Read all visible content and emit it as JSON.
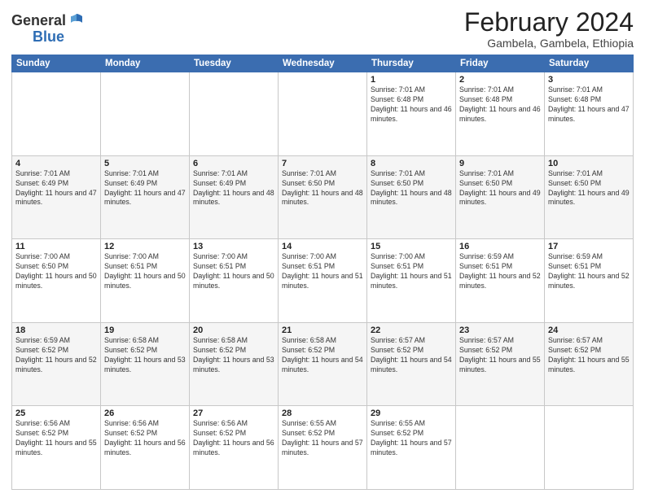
{
  "logo": {
    "general": "General",
    "blue": "Blue"
  },
  "title": "February 2024",
  "subtitle": "Gambela, Gambela, Ethiopia",
  "days_of_week": [
    "Sunday",
    "Monday",
    "Tuesday",
    "Wednesday",
    "Thursday",
    "Friday",
    "Saturday"
  ],
  "weeks": [
    [
      {
        "day": "",
        "info": ""
      },
      {
        "day": "",
        "info": ""
      },
      {
        "day": "",
        "info": ""
      },
      {
        "day": "",
        "info": ""
      },
      {
        "day": "1",
        "info": "Sunrise: 7:01 AM\nSunset: 6:48 PM\nDaylight: 11 hours and 46 minutes."
      },
      {
        "day": "2",
        "info": "Sunrise: 7:01 AM\nSunset: 6:48 PM\nDaylight: 11 hours and 46 minutes."
      },
      {
        "day": "3",
        "info": "Sunrise: 7:01 AM\nSunset: 6:48 PM\nDaylight: 11 hours and 47 minutes."
      }
    ],
    [
      {
        "day": "4",
        "info": "Sunrise: 7:01 AM\nSunset: 6:49 PM\nDaylight: 11 hours and 47 minutes."
      },
      {
        "day": "5",
        "info": "Sunrise: 7:01 AM\nSunset: 6:49 PM\nDaylight: 11 hours and 47 minutes."
      },
      {
        "day": "6",
        "info": "Sunrise: 7:01 AM\nSunset: 6:49 PM\nDaylight: 11 hours and 48 minutes."
      },
      {
        "day": "7",
        "info": "Sunrise: 7:01 AM\nSunset: 6:50 PM\nDaylight: 11 hours and 48 minutes."
      },
      {
        "day": "8",
        "info": "Sunrise: 7:01 AM\nSunset: 6:50 PM\nDaylight: 11 hours and 48 minutes."
      },
      {
        "day": "9",
        "info": "Sunrise: 7:01 AM\nSunset: 6:50 PM\nDaylight: 11 hours and 49 minutes."
      },
      {
        "day": "10",
        "info": "Sunrise: 7:01 AM\nSunset: 6:50 PM\nDaylight: 11 hours and 49 minutes."
      }
    ],
    [
      {
        "day": "11",
        "info": "Sunrise: 7:00 AM\nSunset: 6:50 PM\nDaylight: 11 hours and 50 minutes."
      },
      {
        "day": "12",
        "info": "Sunrise: 7:00 AM\nSunset: 6:51 PM\nDaylight: 11 hours and 50 minutes."
      },
      {
        "day": "13",
        "info": "Sunrise: 7:00 AM\nSunset: 6:51 PM\nDaylight: 11 hours and 50 minutes."
      },
      {
        "day": "14",
        "info": "Sunrise: 7:00 AM\nSunset: 6:51 PM\nDaylight: 11 hours and 51 minutes."
      },
      {
        "day": "15",
        "info": "Sunrise: 7:00 AM\nSunset: 6:51 PM\nDaylight: 11 hours and 51 minutes."
      },
      {
        "day": "16",
        "info": "Sunrise: 6:59 AM\nSunset: 6:51 PM\nDaylight: 11 hours and 52 minutes."
      },
      {
        "day": "17",
        "info": "Sunrise: 6:59 AM\nSunset: 6:51 PM\nDaylight: 11 hours and 52 minutes."
      }
    ],
    [
      {
        "day": "18",
        "info": "Sunrise: 6:59 AM\nSunset: 6:52 PM\nDaylight: 11 hours and 52 minutes."
      },
      {
        "day": "19",
        "info": "Sunrise: 6:58 AM\nSunset: 6:52 PM\nDaylight: 11 hours and 53 minutes."
      },
      {
        "day": "20",
        "info": "Sunrise: 6:58 AM\nSunset: 6:52 PM\nDaylight: 11 hours and 53 minutes."
      },
      {
        "day": "21",
        "info": "Sunrise: 6:58 AM\nSunset: 6:52 PM\nDaylight: 11 hours and 54 minutes."
      },
      {
        "day": "22",
        "info": "Sunrise: 6:57 AM\nSunset: 6:52 PM\nDaylight: 11 hours and 54 minutes."
      },
      {
        "day": "23",
        "info": "Sunrise: 6:57 AM\nSunset: 6:52 PM\nDaylight: 11 hours and 55 minutes."
      },
      {
        "day": "24",
        "info": "Sunrise: 6:57 AM\nSunset: 6:52 PM\nDaylight: 11 hours and 55 minutes."
      }
    ],
    [
      {
        "day": "25",
        "info": "Sunrise: 6:56 AM\nSunset: 6:52 PM\nDaylight: 11 hours and 55 minutes."
      },
      {
        "day": "26",
        "info": "Sunrise: 6:56 AM\nSunset: 6:52 PM\nDaylight: 11 hours and 56 minutes."
      },
      {
        "day": "27",
        "info": "Sunrise: 6:56 AM\nSunset: 6:52 PM\nDaylight: 11 hours and 56 minutes."
      },
      {
        "day": "28",
        "info": "Sunrise: 6:55 AM\nSunset: 6:52 PM\nDaylight: 11 hours and 57 minutes."
      },
      {
        "day": "29",
        "info": "Sunrise: 6:55 AM\nSunset: 6:52 PM\nDaylight: 11 hours and 57 minutes."
      },
      {
        "day": "",
        "info": ""
      },
      {
        "day": "",
        "info": ""
      }
    ]
  ]
}
